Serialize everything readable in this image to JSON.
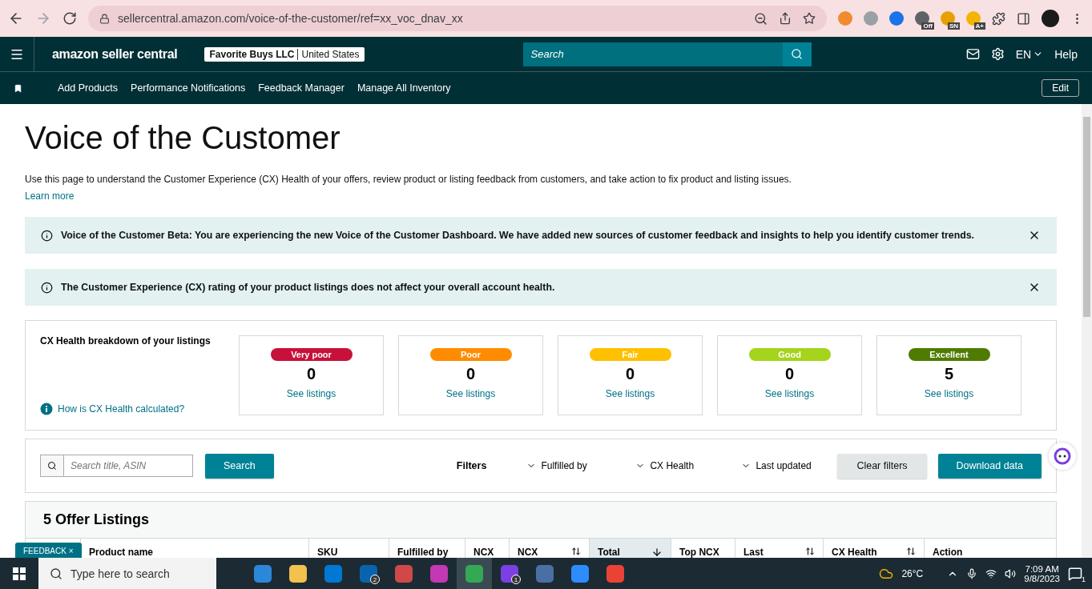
{
  "browser": {
    "url": "sellercentral.amazon.com/voice-of-the-customer/ref=xx_voc_dnav_xx",
    "extensions": [
      {
        "color": "#f28b30"
      },
      {
        "color": "#9aa0a6"
      },
      {
        "color": "#1a73e8"
      },
      {
        "color": "#5f6368",
        "badge": "Off"
      },
      {
        "color": "#e8a000",
        "badge": "SN"
      },
      {
        "color": "#f4b400",
        "badge": "A+"
      }
    ]
  },
  "header": {
    "logo": "amazon seller central",
    "account": {
      "name": "Favorite Buys LLC",
      "region": "United States"
    },
    "search_placeholder": "Search",
    "language": "EN",
    "help": "Help"
  },
  "nav": {
    "items": [
      "Add Products",
      "Performance Notifications",
      "Feedback Manager",
      "Manage All Inventory"
    ],
    "edit": "Edit"
  },
  "page": {
    "title": "Voice of the Customer",
    "description": "Use this page to understand the Customer Experience (CX) Health of your offers, review product or listing feedback from customers, and take action to fix product and listing issues.",
    "learn_more": "Learn more"
  },
  "alerts": [
    "Voice of the Customer Beta: You are experiencing the new Voice of the Customer Dashboard. We have added new sources of customer feedback and insights to help you identify customer trends.",
    "The Customer Experience (CX) rating of your product listings does not affect your overall account health."
  ],
  "breakdown": {
    "title": "CX Health breakdown of your listings",
    "help_link": "How is CX Health calculated?",
    "cards": [
      {
        "label": "Very poor",
        "count": "0",
        "link": "See listings",
        "color": "#c7113a"
      },
      {
        "label": "Poor",
        "count": "0",
        "link": "See listings",
        "color": "#ff8c00"
      },
      {
        "label": "Fair",
        "count": "0",
        "link": "See listings",
        "color": "#ffc000"
      },
      {
        "label": "Good",
        "count": "0",
        "link": "See listings",
        "color": "#a4d41c"
      },
      {
        "label": "Excellent",
        "count": "5",
        "link": "See listings",
        "color": "#4f7c00"
      }
    ]
  },
  "filters": {
    "search_placeholder": "Search title, ASIN",
    "search_button": "Search",
    "label": "Filters",
    "dropdowns": [
      "Fulfilled by",
      "CX Health",
      "Last updated"
    ],
    "clear": "Clear filters",
    "download": "Download data"
  },
  "listings": {
    "title": "5 Offer Listings",
    "columns": [
      {
        "label": "Product name",
        "sortable": false,
        "selected": false
      },
      {
        "label": "SKU",
        "sortable": false,
        "selected": false
      },
      {
        "label": "Fulfilled by",
        "sortable": false,
        "selected": false
      },
      {
        "label": "NCX",
        "sortable": false,
        "selected": false
      },
      {
        "label": "NCX",
        "sortable": true,
        "selected": false
      },
      {
        "label": "Total",
        "sortable": true,
        "selected": true
      },
      {
        "label": "Top NCX",
        "sortable": false,
        "selected": false
      },
      {
        "label": "Last",
        "sortable": true,
        "selected": false
      },
      {
        "label": "CX Health",
        "sortable": true,
        "selected": false
      },
      {
        "label": "Action",
        "sortable": false,
        "selected": false
      }
    ]
  },
  "feedback_tab": "FEEDBACK ×",
  "taskbar": {
    "search_placeholder": "Type here to search",
    "apps": [
      {
        "color": "#2b88d8",
        "selected": false
      },
      {
        "color": "#f2c14e",
        "selected": false
      },
      {
        "color": "#0078d4",
        "selected": false
      },
      {
        "color": "#0a64ad",
        "badge": "2",
        "selected": false
      },
      {
        "color": "#d04848",
        "selected": false
      },
      {
        "color": "#c239b3",
        "selected": false
      },
      {
        "color": "#34a853",
        "selected": true
      },
      {
        "color": "#7b3fe4",
        "badge": "1",
        "selected": false
      },
      {
        "color": "#4a6fa5",
        "selected": false
      },
      {
        "color": "#2d8cff",
        "selected": false
      },
      {
        "color": "#ea4335",
        "selected": false
      }
    ],
    "weather": "26°C",
    "time": "7:09 AM",
    "date": "9/8/2023",
    "notifications": "1"
  }
}
